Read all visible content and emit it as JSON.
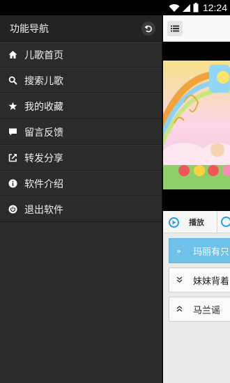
{
  "status_bar": {
    "time": "12:24"
  },
  "drawer": {
    "title": "功能导航",
    "items": [
      {
        "label": "儿歌首页",
        "icon": "home-icon"
      },
      {
        "label": "搜索儿歌",
        "icon": "search-icon"
      },
      {
        "label": "我的收藏",
        "icon": "star-icon"
      },
      {
        "label": "留言反馈",
        "icon": "comment-icon"
      },
      {
        "label": "转发分享",
        "icon": "share-icon"
      },
      {
        "label": "软件介绍",
        "icon": "info-icon"
      },
      {
        "label": "退出软件",
        "icon": "power-icon"
      }
    ]
  },
  "player": {
    "play_label": "播放"
  },
  "playlist": [
    {
      "title": "玛丽有只",
      "state": "playing"
    },
    {
      "title": "妹妹背着",
      "state": "collapsed"
    },
    {
      "title": "马兰谣",
      "state": "expanded"
    }
  ],
  "colors": {
    "drawer_bg": "#2b2b2b",
    "accent": "#2b9adf",
    "active_row": "#6ec2ea"
  }
}
